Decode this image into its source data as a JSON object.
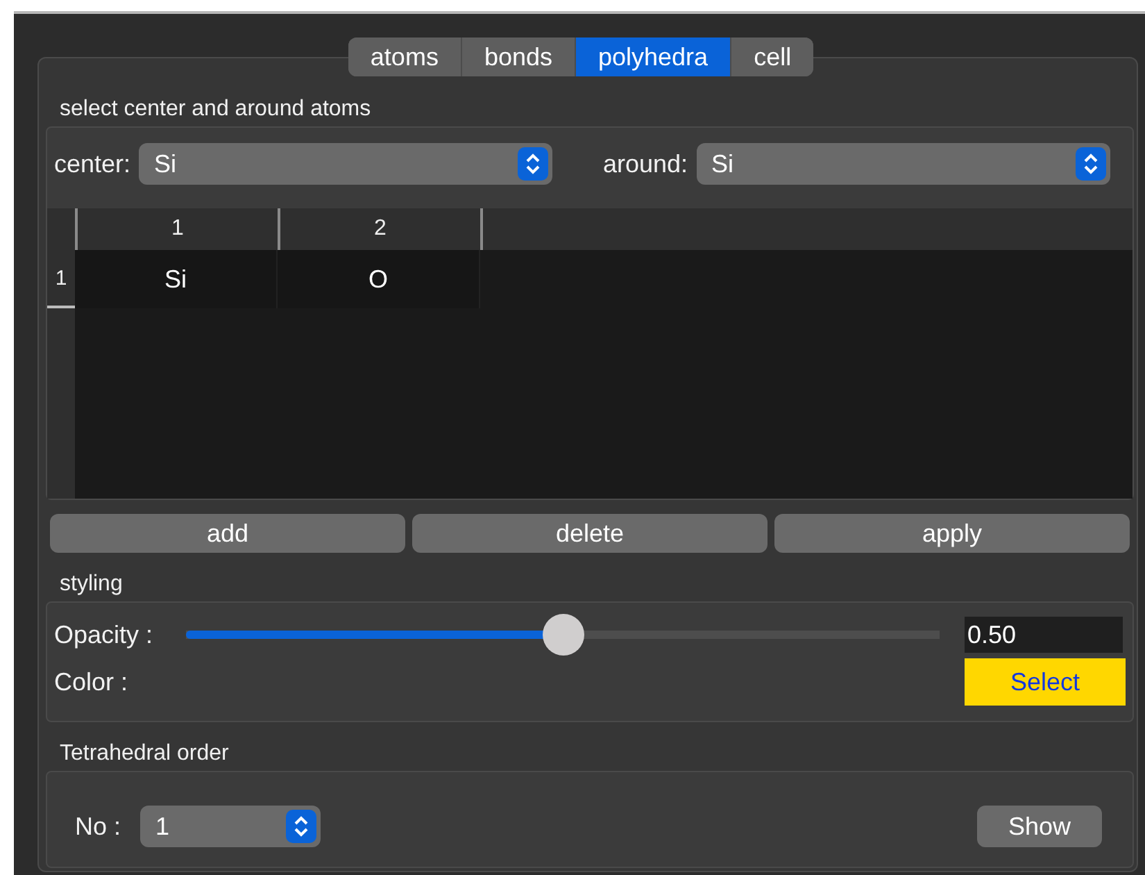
{
  "tabs": [
    {
      "label": "atoms",
      "selected": false
    },
    {
      "label": "bonds",
      "selected": false
    },
    {
      "label": "polyhedra",
      "selected": true
    },
    {
      "label": "cell",
      "selected": false
    }
  ],
  "selection": {
    "title": "select center and around atoms",
    "center": {
      "label": "center:",
      "value": "Si"
    },
    "around": {
      "label": "around:",
      "value": "Si"
    }
  },
  "table": {
    "columns": [
      "1",
      "2"
    ],
    "rows": [
      {
        "header": "1",
        "cells": [
          "Si",
          "O"
        ]
      }
    ]
  },
  "buttons": [
    "add",
    "delete",
    "apply"
  ],
  "styling": {
    "title": "styling",
    "opacity": {
      "label": "Opacity :",
      "level": 0.5,
      "value": "0.50"
    },
    "color": {
      "label": "Color :",
      "button": "Select",
      "color": "#ffd700"
    }
  },
  "tetrahedral": {
    "title": "Tetrahedral order",
    "no": {
      "label": "No :",
      "value": "1"
    },
    "button": "Show"
  }
}
